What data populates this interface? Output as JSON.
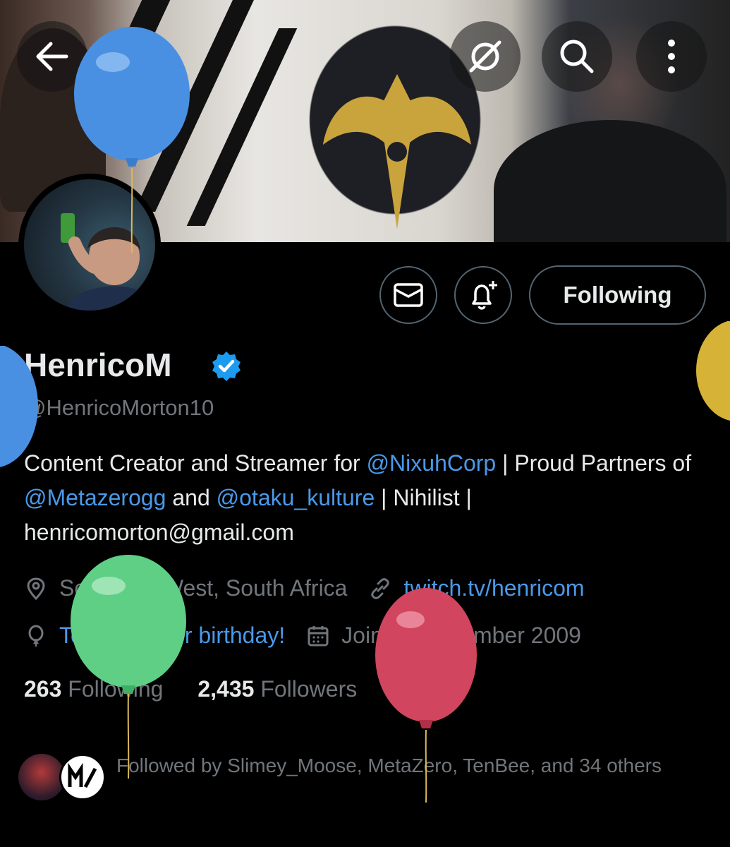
{
  "profile": {
    "name": "HenricoM",
    "handle": "@HenricoMorton10",
    "bio": {
      "p1": "Content Creator and Streamer for ",
      "m1": "@NixuhCorp",
      "p2": " | Proud Partners of ",
      "m2": "@Metazerogg",
      "p3": " and ",
      "m3": "@otaku_kulture",
      "p4": " | Nihilist | henricomorton@gmail.com"
    },
    "location": "Somerset West, South Africa",
    "website": "twitch.tv/henricom",
    "birthday": "Today is their birthday!",
    "joined": "Joined September 2009",
    "following_count": "263",
    "following_label": "Following",
    "followers_count": "2,435",
    "followers_label": "Followers",
    "followed_by": "Followed by Slimey_Moose, MetaZero, TenBee, and 34 others"
  },
  "actions": {
    "following_button": "Following"
  },
  "icons": {
    "back": "back-arrow-icon",
    "grok": "grok-icon",
    "search": "search-icon",
    "more": "more-vertical-icon",
    "message": "envelope-icon",
    "notify": "bell-plus-icon",
    "verified": "verified-badge-icon",
    "location": "location-pin-icon",
    "link": "link-icon",
    "birthday": "balloon-icon",
    "calendar": "calendar-icon"
  },
  "colors": {
    "background": "#000000",
    "text": "#e7e9ea",
    "muted": "#71767b",
    "link": "#4a99e9",
    "verified": "#1d9bf0",
    "border": "#536471"
  }
}
